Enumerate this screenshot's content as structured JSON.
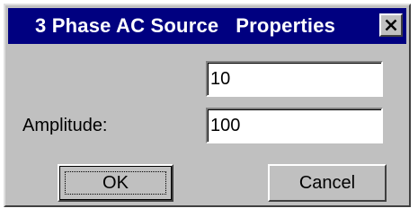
{
  "dialog": {
    "title": "3 Phase AC Source   Properties",
    "close_icon": "close-icon"
  },
  "fields": {
    "top_value": "10",
    "amplitude_label": "Amplitude:",
    "amplitude_value": "100"
  },
  "buttons": {
    "ok_label": "OK",
    "cancel_label": "Cancel"
  },
  "colors": {
    "titlebar": "#000080",
    "face": "#c0c0c0"
  }
}
